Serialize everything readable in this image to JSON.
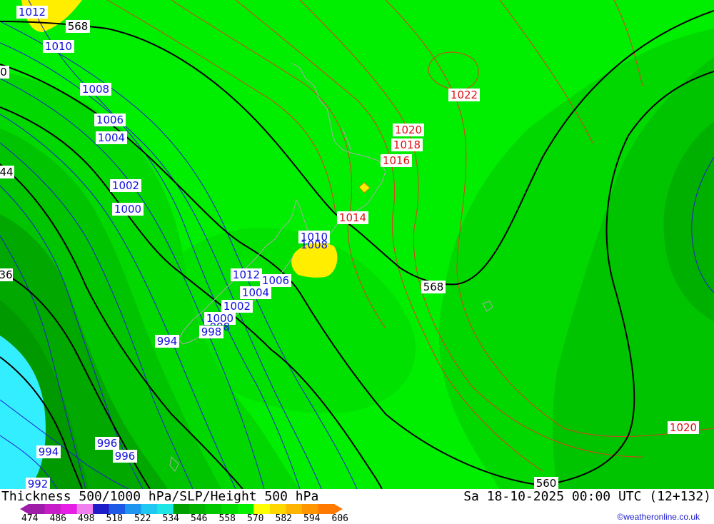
{
  "footer": {
    "title": "Thickness 500/1000 hPa/SLP/Height 500 hPa",
    "time": "Sa 18-10-2025 00:00 UTC (12+132)",
    "credit": "©weatheronline.co.uk"
  },
  "legend": {
    "ticks": [
      "474",
      "486",
      "498",
      "510",
      "522",
      "534",
      "546",
      "558",
      "570",
      "582",
      "594",
      "606"
    ],
    "colors": [
      "#9e1ea8",
      "#c81ec8",
      "#e61ee6",
      "#f080f0",
      "#1e1ec8",
      "#1e5ae6",
      "#1e96f0",
      "#1ec8f0",
      "#1ee6e6",
      "#00a000",
      "#00b400",
      "#00c800",
      "#00dc00",
      "#00f000",
      "#ffff00",
      "#ffd700",
      "#ffb400",
      "#ff9600",
      "#ff7800"
    ]
  },
  "map": {
    "slp_labels": [
      "1012",
      "1010",
      "1008",
      "1006",
      "1004",
      "1002",
      "1000",
      "994",
      "996",
      "996",
      "994",
      "992",
      "1010",
      "1008",
      "1012",
      "1006",
      "1004",
      "1002",
      "1000",
      "998",
      "998",
      "1014",
      "1016",
      "1018",
      "1020",
      "1022",
      "1020"
    ],
    "height_labels": [
      "568",
      "568",
      "560"
    ],
    "edge_labels": [
      "0",
      "44",
      "36"
    ]
  }
}
